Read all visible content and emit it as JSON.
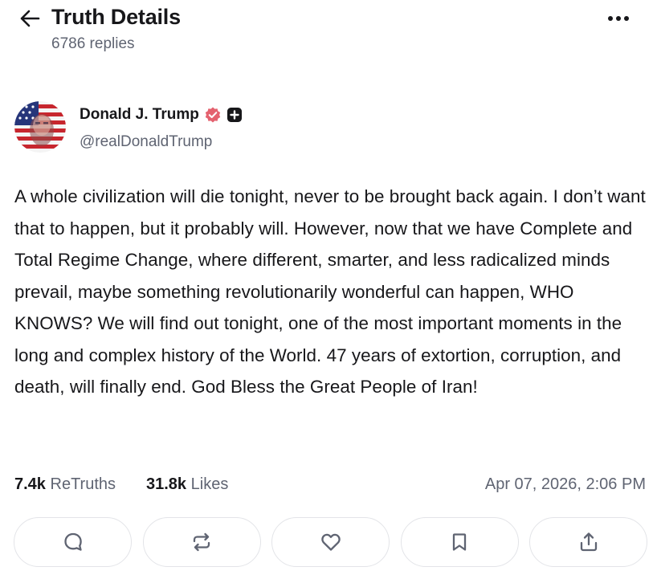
{
  "header": {
    "title": "Truth Details",
    "replies": "6786 replies",
    "back_icon": "arrow-left-icon",
    "more_icon": "ellipsis-icon"
  },
  "author": {
    "name": "Donald J. Trump",
    "handle": "@realDonaldTrump",
    "verified_color": "#e4626f",
    "badge_icon": "plus-badge-icon"
  },
  "post": {
    "text": "A whole civilization will die tonight, never to be brought back again. I don’t want that to happen, but it probably will. However, now that we have Complete and Total Regime Change, where different, smarter, and less radicalized minds prevail, maybe something revolutionarily wonderful can happen, WHO KNOWS? We will find out tonight, one of the most important moments in the long and complex history of the World. 47 years of extortion, corruption, and death, will finally end. God Bless the Great People of Iran!"
  },
  "stats": {
    "retruths_count": "7.4k",
    "retruths_label": "ReTruths",
    "likes_count": "31.8k",
    "likes_label": "Likes",
    "timestamp": "Apr 07, 2026, 2:06 PM"
  },
  "actions": [
    {
      "icon": "reply-icon"
    },
    {
      "icon": "retruth-icon"
    },
    {
      "icon": "heart-icon"
    },
    {
      "icon": "bookmark-icon"
    },
    {
      "icon": "share-icon"
    }
  ]
}
